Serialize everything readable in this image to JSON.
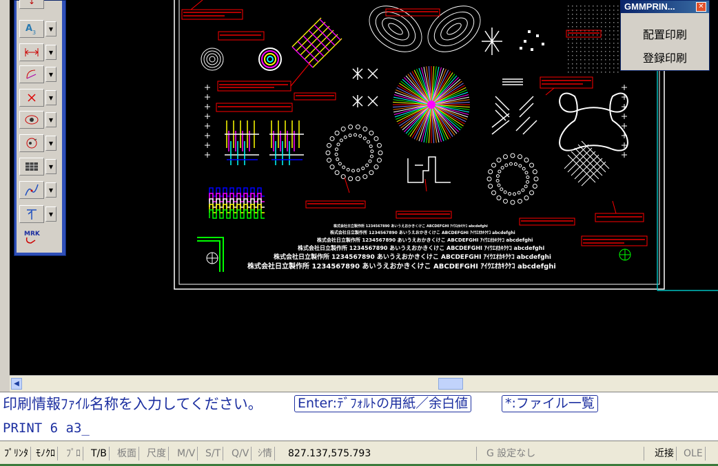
{
  "popup": {
    "title": "GMMPRIN...",
    "items": [
      "配置印刷",
      "登録印刷"
    ]
  },
  "command": {
    "prompt": "印刷情報ﾌｧｲﾙ名称を入力してください。",
    "buttons": [
      "Enter:ﾃﾞﾌｫﾙﾄの用紙／余白値",
      "*:ファイル一覧"
    ],
    "input_value": "PRINT 6 a3_"
  },
  "status": {
    "items": [
      {
        "label": "ﾌﾟﾘﾝﾀ",
        "active": true
      },
      {
        "label": "ﾓﾉｸﾛ",
        "active": true
      },
      {
        "label": "ﾌﾟﾛ",
        "active": false
      },
      {
        "label": "T/B",
        "active": true
      },
      {
        "label": "板面",
        "active": false
      },
      {
        "label": "尺度",
        "active": false
      },
      {
        "label": "M/V",
        "active": false
      },
      {
        "label": "S/T",
        "active": false
      },
      {
        "label": "Q/V",
        "active": false
      },
      {
        "label": "ｼ情",
        "active": false
      }
    ],
    "coordinates": "827.137,575.793",
    "grid_setting": "G 設定なし",
    "snap": "近接",
    "ole": "OLE"
  },
  "drawing_text": {
    "font_samples": [
      "株式会社日立製作所 1234567890 あいうえおかきくけこ ABCDEFGHI ｱｲｳｴｵｶｷｸｹｺ abcdefghi",
      "株式会社日立製作所 1234567890 あいうえおかきくけこ ABCDEFGHI ｱｲｳｴｵｶｷｸｹｺ abcdefghi",
      "株式会社日立製作所 1234567890 あいうえおかきくけこ ABCDEFGHI ｱｲｳｴｵｶｷｸｹｺ abcdefghi",
      "株式会社日立製作所 1234567890 あいうえおかきくけこ ABCDEFGHI ｱｲｳｴｵｶｷｸｹｺ abcdefghi",
      "株式会社日立製作所 1234567890 あいうえおかきくけこ ABCDEFGHI ｱｲｳｴｵｶｷｸｹｺ abcdefghi",
      "株式会社日立製作所 1234567890 あいうえおかきくけこ ABCDEFGHI ｱｲｳｴｵｶｷｸｹｺ abcdefghi"
    ],
    "toolbar_label": "MRK"
  },
  "toolbar": {
    "icons": [
      "dim-text-icon",
      "text-style-icon",
      "dimension-icon",
      "arc-dimension-icon",
      "delete-icon",
      "view-icon",
      "rotate-view-icon",
      "table-icon",
      "curve-icon",
      "leader-icon",
      "mark-icon"
    ]
  },
  "colors": {
    "canvas": "#000000",
    "annotation": "#ff0000",
    "frame": "#ffffff",
    "border_cyan": "#00c0c0",
    "prompt_text": "#1c2fa0"
  }
}
